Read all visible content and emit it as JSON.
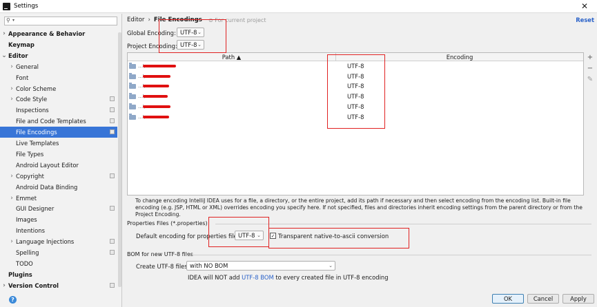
{
  "window": {
    "title": "Settings"
  },
  "search": {
    "placeholder": ""
  },
  "sidebar": {
    "items": [
      {
        "label": "Appearance & Behavior",
        "bold": true,
        "arrow": "›",
        "indent": 0,
        "selected": false,
        "project": false
      },
      {
        "label": "Keymap",
        "bold": true,
        "arrow": "",
        "indent": 0,
        "selected": false,
        "project": false
      },
      {
        "label": "Editor",
        "bold": true,
        "arrow": "⌄",
        "indent": 0,
        "selected": false,
        "project": false
      },
      {
        "label": "General",
        "bold": false,
        "arrow": "›",
        "indent": 1,
        "selected": false,
        "project": false
      },
      {
        "label": "Font",
        "bold": false,
        "arrow": "",
        "indent": 1,
        "selected": false,
        "project": false
      },
      {
        "label": "Color Scheme",
        "bold": false,
        "arrow": "›",
        "indent": 1,
        "selected": false,
        "project": false
      },
      {
        "label": "Code Style",
        "bold": false,
        "arrow": "›",
        "indent": 1,
        "selected": false,
        "project": true
      },
      {
        "label": "Inspections",
        "bold": false,
        "arrow": "",
        "indent": 1,
        "selected": false,
        "project": true
      },
      {
        "label": "File and Code Templates",
        "bold": false,
        "arrow": "",
        "indent": 1,
        "selected": false,
        "project": true
      },
      {
        "label": "File Encodings",
        "bold": false,
        "arrow": "",
        "indent": 1,
        "selected": true,
        "project": true
      },
      {
        "label": "Live Templates",
        "bold": false,
        "arrow": "",
        "indent": 1,
        "selected": false,
        "project": false
      },
      {
        "label": "File Types",
        "bold": false,
        "arrow": "",
        "indent": 1,
        "selected": false,
        "project": false
      },
      {
        "label": "Android Layout Editor",
        "bold": false,
        "arrow": "",
        "indent": 1,
        "selected": false,
        "project": false
      },
      {
        "label": "Copyright",
        "bold": false,
        "arrow": "›",
        "indent": 1,
        "selected": false,
        "project": true
      },
      {
        "label": "Android Data Binding",
        "bold": false,
        "arrow": "",
        "indent": 1,
        "selected": false,
        "project": false
      },
      {
        "label": "Emmet",
        "bold": false,
        "arrow": "›",
        "indent": 1,
        "selected": false,
        "project": false
      },
      {
        "label": "GUI Designer",
        "bold": false,
        "arrow": "",
        "indent": 1,
        "selected": false,
        "project": true
      },
      {
        "label": "Images",
        "bold": false,
        "arrow": "",
        "indent": 1,
        "selected": false,
        "project": false
      },
      {
        "label": "Intentions",
        "bold": false,
        "arrow": "",
        "indent": 1,
        "selected": false,
        "project": false
      },
      {
        "label": "Language Injections",
        "bold": false,
        "arrow": "›",
        "indent": 1,
        "selected": false,
        "project": true
      },
      {
        "label": "Spelling",
        "bold": false,
        "arrow": "",
        "indent": 1,
        "selected": false,
        "project": true
      },
      {
        "label": "TODO",
        "bold": false,
        "arrow": "",
        "indent": 1,
        "selected": false,
        "project": false
      },
      {
        "label": "Plugins",
        "bold": true,
        "arrow": "",
        "indent": 0,
        "selected": false,
        "project": false
      },
      {
        "label": "Version Control",
        "bold": true,
        "arrow": "›",
        "indent": 0,
        "selected": false,
        "project": true
      }
    ]
  },
  "breadcrumb": {
    "parent": "Editor",
    "separator": "›",
    "current": "File Encodings",
    "hint": "For current project"
  },
  "reset_label": "Reset",
  "global_encoding": {
    "label": "Global Encoding:",
    "value": "UTF-8"
  },
  "project_encoding": {
    "label": "Project Encoding:",
    "value": "UTF-8"
  },
  "table": {
    "columns": [
      "Path ▲",
      "Encoding"
    ],
    "rows": [
      {
        "path": "...\\",
        "encoding": "UTF-8"
      },
      {
        "path": "...\\",
        "encoding": "UTF-8"
      },
      {
        "path": "...\\",
        "encoding": "UTF-8"
      },
      {
        "path": "...\\",
        "encoding": "UTF-8"
      },
      {
        "path": "...\\",
        "encoding": "UTF-8"
      },
      {
        "path": "...\\",
        "encoding": "UTF-8"
      }
    ]
  },
  "table_tools": {
    "add": "+",
    "remove": "−",
    "edit": "✎"
  },
  "description": "To change encoding IntelliJ IDEA uses for a file, a directory, or the entire project, add its path if necessary and then select encoding from the encoding list. Built-in file encoding (e.g. JSP, HTML or XML) overrides encoding you specify here. If not specified, files and directories inherit encoding settings from the parent directory or from the Project Encoding.",
  "properties": {
    "title": "Properties Files (*.properties)",
    "default_label": "Default encoding for properties files:",
    "default_value": "UTF-8",
    "native_label": "Transparent native-to-ascii conversion",
    "native_checked": true
  },
  "bom": {
    "title": "BOM for new UTF-8 files",
    "create_label": "Create UTF-8 files:",
    "create_value": "with NO BOM",
    "note_before": "IDEA will NOT add",
    "note_link": "UTF-8 BOM",
    "note_after": "to every created file in UTF-8 encoding"
  },
  "buttons": {
    "ok": "OK",
    "cancel": "Cancel",
    "apply": "Apply"
  },
  "help_label": "?",
  "colors": {
    "selection": "#3875d7",
    "link": "#2a62c9",
    "annotation_red": "#e02020"
  }
}
